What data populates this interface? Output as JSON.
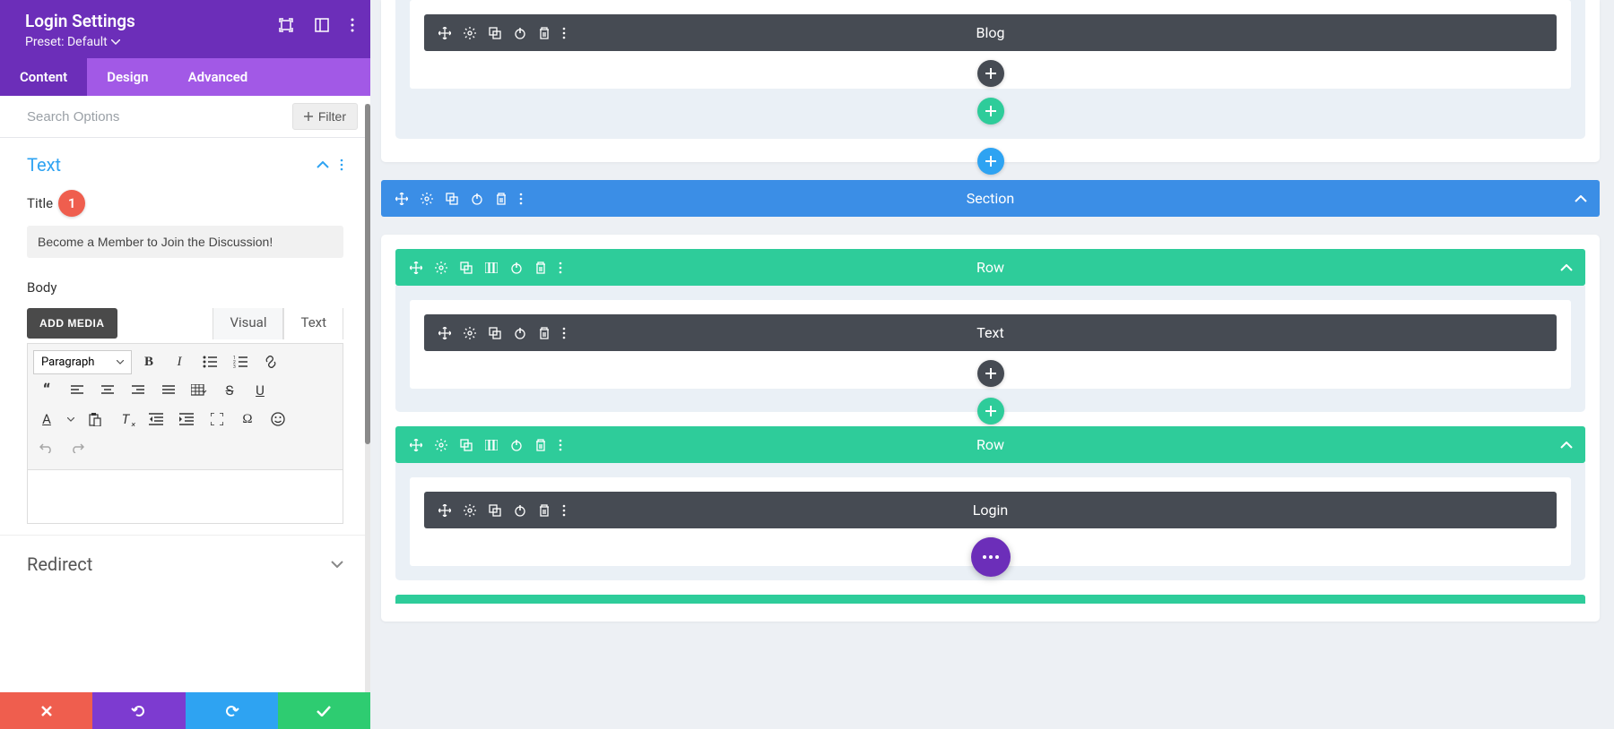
{
  "header": {
    "title": "Login Settings",
    "preset_label": "Preset: Default"
  },
  "tabs": [
    {
      "label": "Content",
      "active": true
    },
    {
      "label": "Design",
      "active": false
    },
    {
      "label": "Advanced",
      "active": false
    }
  ],
  "search": {
    "placeholder": "Search Options",
    "filter_label": "Filter"
  },
  "text_section": {
    "title": "Text",
    "badge": "1",
    "title_field": {
      "label": "Title",
      "value": "Become a Member to Join the Discussion!"
    },
    "body_field": {
      "label": "Body",
      "add_media": "ADD MEDIA",
      "editor_tabs": {
        "visual": "Visual",
        "text": "Text"
      },
      "paragraph_label": "Paragraph"
    }
  },
  "redirect_section": {
    "title": "Redirect"
  },
  "canvas": {
    "module_blog": "Blog",
    "section": "Section",
    "row": "Row",
    "module_text": "Text",
    "module_login": "Login"
  },
  "colors": {
    "purple": "#6c2eb9",
    "purple_light": "#a259e6",
    "blue": "#2ea3f2",
    "green": "#2ecc9a",
    "red": "#ef5e4e",
    "dark": "#464b53"
  }
}
